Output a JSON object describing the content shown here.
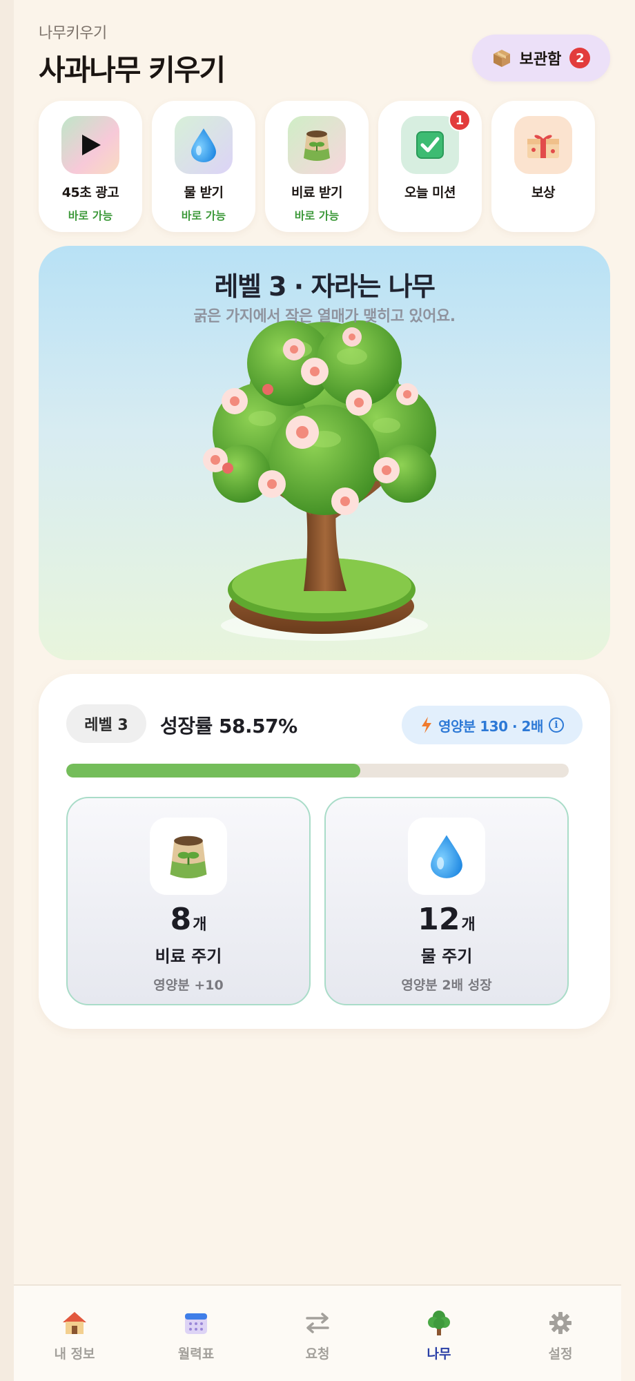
{
  "header": {
    "subtitle": "나무키우기",
    "title": "사과나무 키우기",
    "storage": {
      "label": "보관함",
      "badge": "2",
      "icon": "package-icon"
    }
  },
  "actions": [
    {
      "name": "45초 광고",
      "status": "바로 가능",
      "icon": "play-icon"
    },
    {
      "name": "물 받기",
      "status": "바로 가능",
      "icon": "water-drop-icon"
    },
    {
      "name": "비료 받기",
      "status": "바로 가능",
      "icon": "fertilizer-bag-icon"
    },
    {
      "name": "오늘 미션",
      "status": "",
      "badge": "1",
      "icon": "checkbox-icon"
    },
    {
      "name": "보상",
      "status": "",
      "icon": "gift-box-icon"
    }
  ],
  "scene": {
    "title": "레벨 3 · 자라는 나무",
    "description": "굵은 가지에서 작은 열매가 맺히고 있어요."
  },
  "stats": {
    "level": "레벨 3",
    "growth": "성장률 58.57%",
    "growth_fraction": 0.5857,
    "nutrition": "영양분 130 · 2배",
    "items": [
      {
        "count": "8",
        "unit": "개",
        "label": "비료 주기",
        "sub": "영양분 +10",
        "icon": "fertilizer-bag-icon"
      },
      {
        "count": "12",
        "unit": "개",
        "label": "물 주기",
        "sub": "영양분 2배 성장",
        "icon": "water-drop-icon"
      }
    ]
  },
  "nav": [
    {
      "label": "내 정보",
      "icon": "house-icon"
    },
    {
      "label": "월력표",
      "icon": "calendar-icon"
    },
    {
      "label": "요청",
      "icon": "swap-arrows-icon"
    },
    {
      "label": "나무",
      "icon": "tree-icon",
      "active": true
    },
    {
      "label": "설정",
      "icon": "gear-icon"
    }
  ],
  "colors": {
    "accent_green": "#74bd5a",
    "nav_active": "#2a3fa6",
    "badge_red": "#e23c3c",
    "nutrition_blue": "#2d79d6"
  }
}
